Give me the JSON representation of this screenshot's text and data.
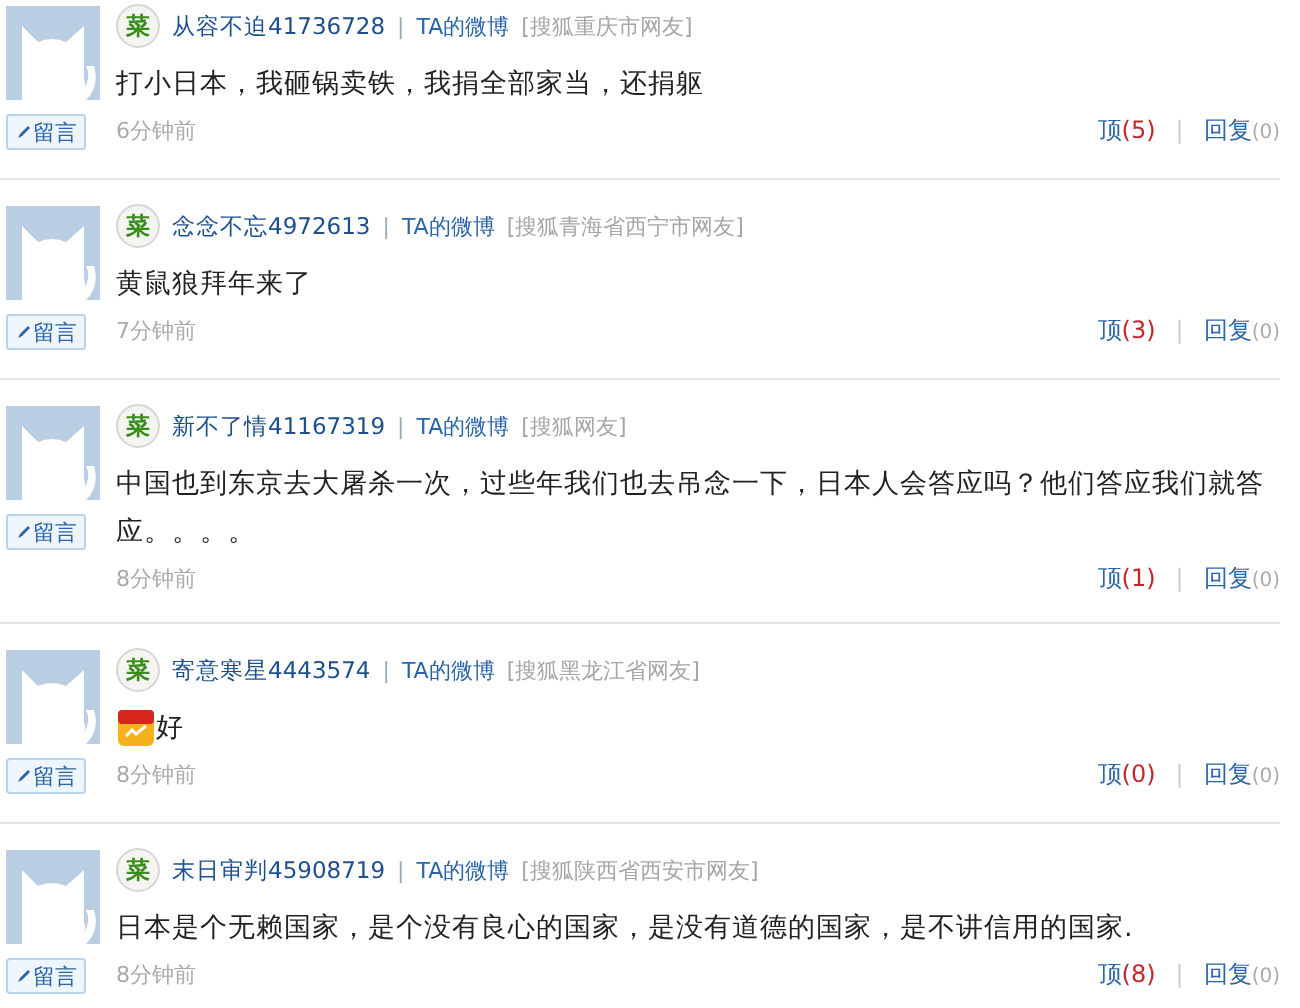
{
  "comments": [
    {
      "badge": "菜",
      "user": "从容不迫41736728",
      "separator": "|",
      "weibo": "TA的微博",
      "location": "[搜狐重庆市网友]",
      "text": "打小日本，我砸锅卖铁，我捐全部家当，还捐躯",
      "emoticon": false,
      "time": "6分钟前",
      "button": "留言",
      "up_label": "顶",
      "up_count": "(5)",
      "action_separator": "|",
      "reply_label": "回复",
      "reply_count": "(0)"
    },
    {
      "badge": "菜",
      "user": "念念不忘4972613",
      "separator": "|",
      "weibo": "TA的微博",
      "location": "[搜狐青海省西宁市网友]",
      "text": "黄鼠狼拜年来了",
      "emoticon": false,
      "time": "7分钟前",
      "button": "留言",
      "up_label": "顶",
      "up_count": "(3)",
      "action_separator": "|",
      "reply_label": "回复",
      "reply_count": "(0)"
    },
    {
      "badge": "菜",
      "user": "新不了情41167319",
      "separator": "|",
      "weibo": "TA的微博",
      "location": "[搜狐网友]",
      "text": "中国也到东京去大屠杀一次，过些年我们也去吊念一下，日本人会答应吗？他们答应我们就答应。。。。",
      "emoticon": false,
      "time": "8分钟前",
      "button": "留言",
      "up_label": "顶",
      "up_count": "(1)",
      "action_separator": "|",
      "reply_label": "回复",
      "reply_count": "(0)"
    },
    {
      "badge": "菜",
      "user": "寄意寒星4443574",
      "separator": "|",
      "weibo": "TA的微博",
      "location": "[搜狐黑龙江省网友]",
      "text": "好",
      "emoticon": true,
      "time": "8分钟前",
      "button": "留言",
      "up_label": "顶",
      "up_count": "(0)",
      "action_separator": "|",
      "reply_label": "回复",
      "reply_count": "(0)"
    },
    {
      "badge": "菜",
      "user": "末日审判45908719",
      "separator": "|",
      "weibo": "TA的微博",
      "location": "[搜狐陕西省西安市网友]",
      "text": "日本是个无赖国家，是个没有良心的国家，是没有道德的国家，是不讲信用的国家.",
      "emoticon": false,
      "time": "8分钟前",
      "button": "留言",
      "up_label": "顶",
      "up_count": "(8)",
      "action_separator": "|",
      "reply_label": "回复",
      "reply_count": "(0)"
    }
  ]
}
